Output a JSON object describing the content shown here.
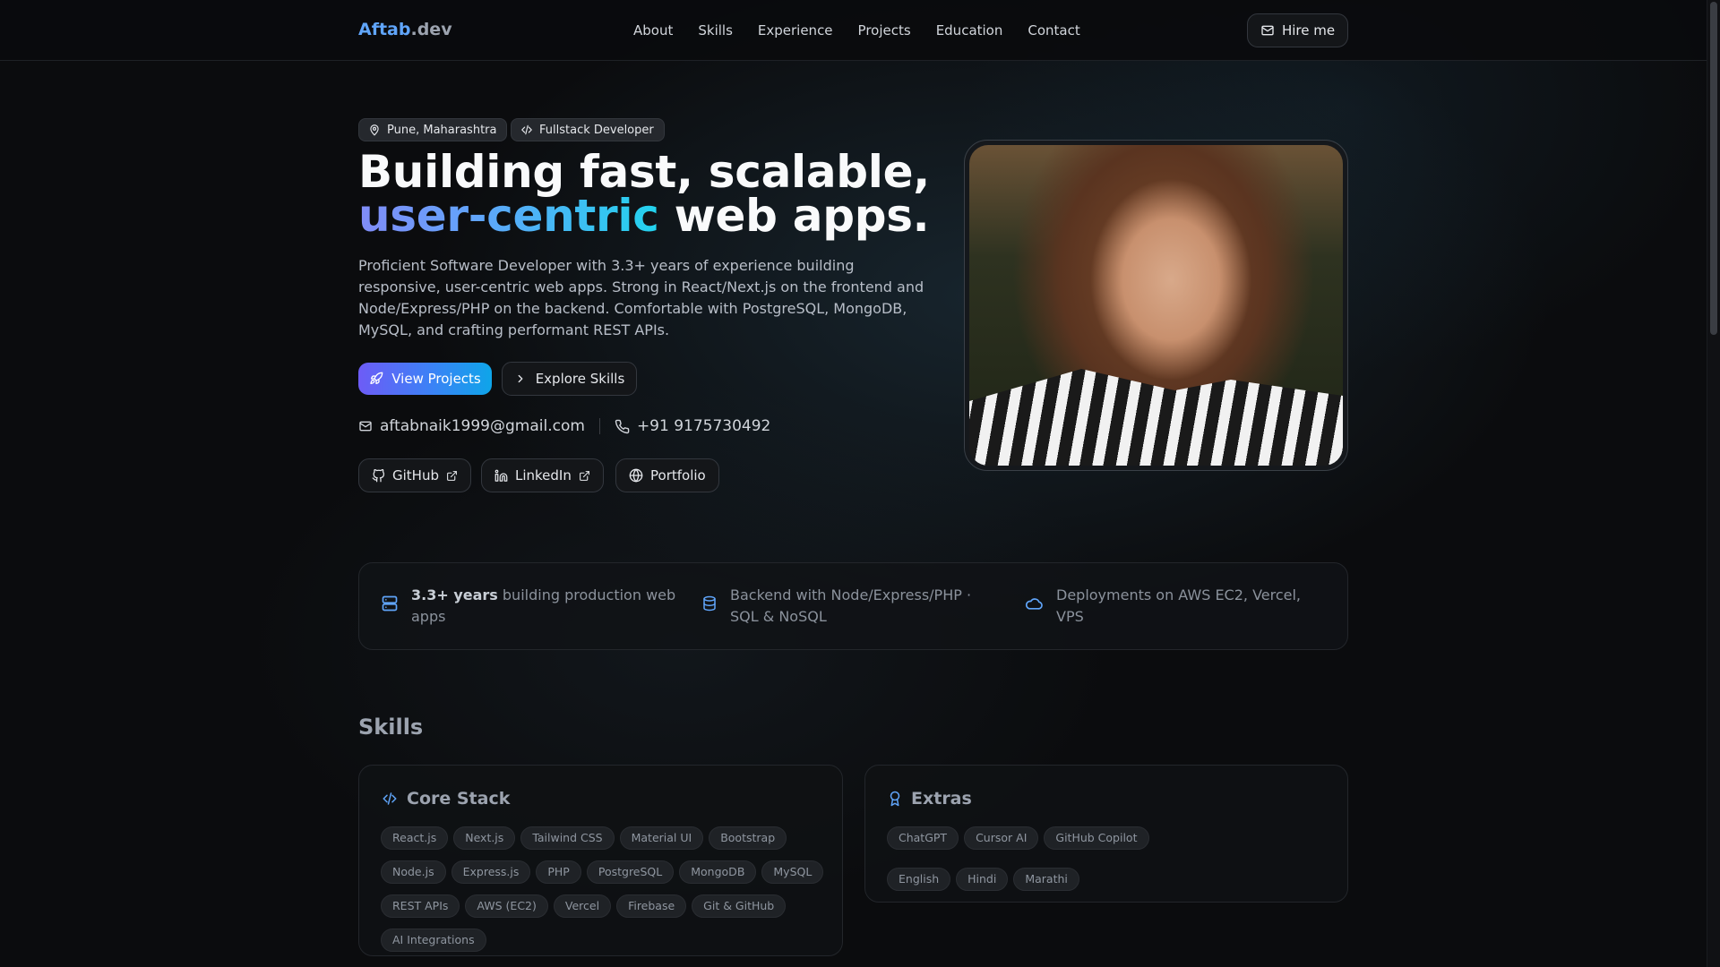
{
  "header": {
    "logo_main": "Aftab",
    "logo_suffix": ".dev",
    "nav": [
      "About",
      "Skills",
      "Experience",
      "Projects",
      "Education",
      "Contact"
    ],
    "hire_label": "Hire me"
  },
  "hero": {
    "chips": {
      "location": "Pune, Maharashtra",
      "role": "Fullstack Developer"
    },
    "headline_line1": "Building fast, scalable,",
    "headline_accent": "user-centric",
    "headline_rest": " web apps.",
    "description": "Proficient Software Developer with 3.3+ years of experience building responsive, user-centric web apps. Strong in React/Next.js on the frontend and Node/Express/PHP on the backend. Comfortable with PostgreSQL, MongoDB, MySQL, and crafting performant REST APIs.",
    "primary_label": "View Projects",
    "secondary_label": "Explore Skills",
    "email": "aftabnaik1999@gmail.com",
    "phone": "+91 9175730492",
    "social": {
      "github": "GitHub",
      "linkedin": "LinkedIn",
      "portfolio": "Portfolio"
    }
  },
  "stats": [
    {
      "bold": "3.3+ years",
      "text": " building production web apps",
      "icon": "server-icon"
    },
    {
      "bold": "",
      "text": "Backend with Node/Express/PHP · SQL & NoSQL",
      "icon": "database-icon"
    },
    {
      "bold": "",
      "text": "Deployments on AWS EC2, Vercel, VPS",
      "icon": "cloud-icon"
    }
  ],
  "skills": {
    "title": "Skills",
    "core": {
      "title": "Core Stack",
      "rows": [
        [
          "React.js",
          "Next.js",
          "Tailwind CSS",
          "Material UI",
          "Bootstrap"
        ],
        [
          "Node.js",
          "Express.js",
          "PHP",
          "PostgreSQL",
          "MongoDB",
          "MySQL"
        ],
        [
          "REST APIs",
          "AWS (EC2)",
          "Vercel",
          "Firebase",
          "Git & GitHub"
        ],
        [
          "AI Integrations"
        ]
      ]
    },
    "extras": {
      "title": "Extras",
      "rows": [
        [
          "ChatGPT",
          "Cursor AI",
          "GitHub Copilot"
        ],
        [
          "English",
          "Hindi",
          "Marathi"
        ]
      ]
    }
  },
  "colors": {
    "accent": "#60a5fa",
    "gradient_start": "#818cf8",
    "gradient_end": "#22d3ee"
  }
}
